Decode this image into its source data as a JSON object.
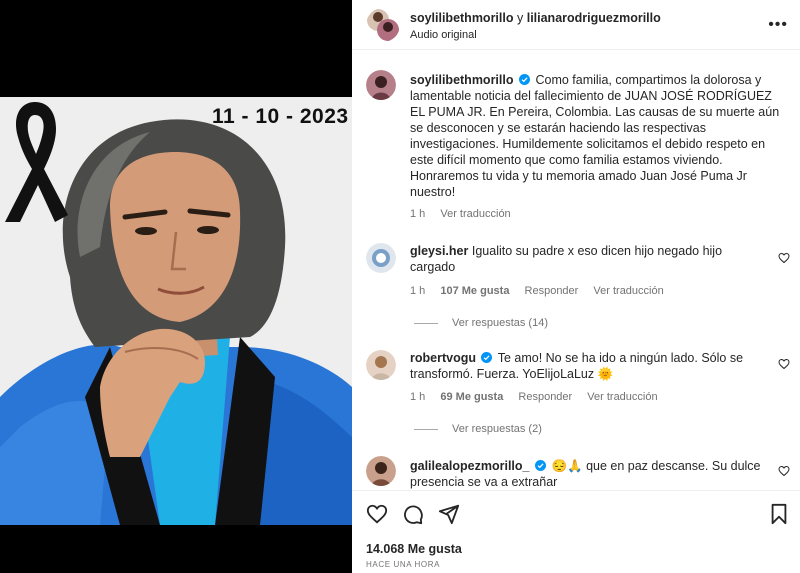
{
  "media": {
    "date": "11 - 10 - 2023"
  },
  "header": {
    "user1": "soylilibethmorillo",
    "and_word": "y",
    "user2": "lilianarodriguezmorillo",
    "audio": "Audio original",
    "more_icon": "more-horizontal-icon"
  },
  "caption": {
    "username": "soylilibethmorillo",
    "text": "Como familia, compartimos la dolorosa y lamentable noticia del fallecimiento de JUAN JOSÉ RODRÍGUEZ EL PUMA JR. En Pereira, Colombia. Las causas de su muerte aún se desconocen y se estarán haciendo las respectivas investigaciones. Humildemente solicitamos el debido respeto en este difícil momento que como familia estamos viviendo. Honraremos tu vida y tu memoria amado Juan José Puma Jr nuestro!",
    "time": "1 h",
    "translate": "Ver traducción"
  },
  "comments": [
    {
      "username": "gleysi.her",
      "text": "Igualito su padre x eso dicen hijo negado hijo cargado",
      "time": "1 h",
      "likes": "107 Me gusta",
      "reply": "Responder",
      "translate": "Ver traducción",
      "replies": "Ver respuestas (14)"
    },
    {
      "username": "robertvogu",
      "text": "Te amo! No se ha ido a ningún lado. Sólo se transformó. Fuerza. YoElijoLaLuz",
      "emoji": "🌞",
      "time": "1 h",
      "likes": "69 Me gusta",
      "reply": "Responder",
      "translate": "Ver traducción",
      "replies": "Ver respuestas (2)"
    },
    {
      "username": "galilealopezmorillo_",
      "emoji": "😔🙏",
      "text": "que en paz descanse. Su dulce presencia se va a extrañar"
    }
  ],
  "footer": {
    "likes": "14.068 Me gusta",
    "time": "HACE UNA HORA"
  },
  "colors": {
    "verified": "#0095f6",
    "jacket": "#1f6fd0",
    "shirt": "#1ba8e0"
  }
}
